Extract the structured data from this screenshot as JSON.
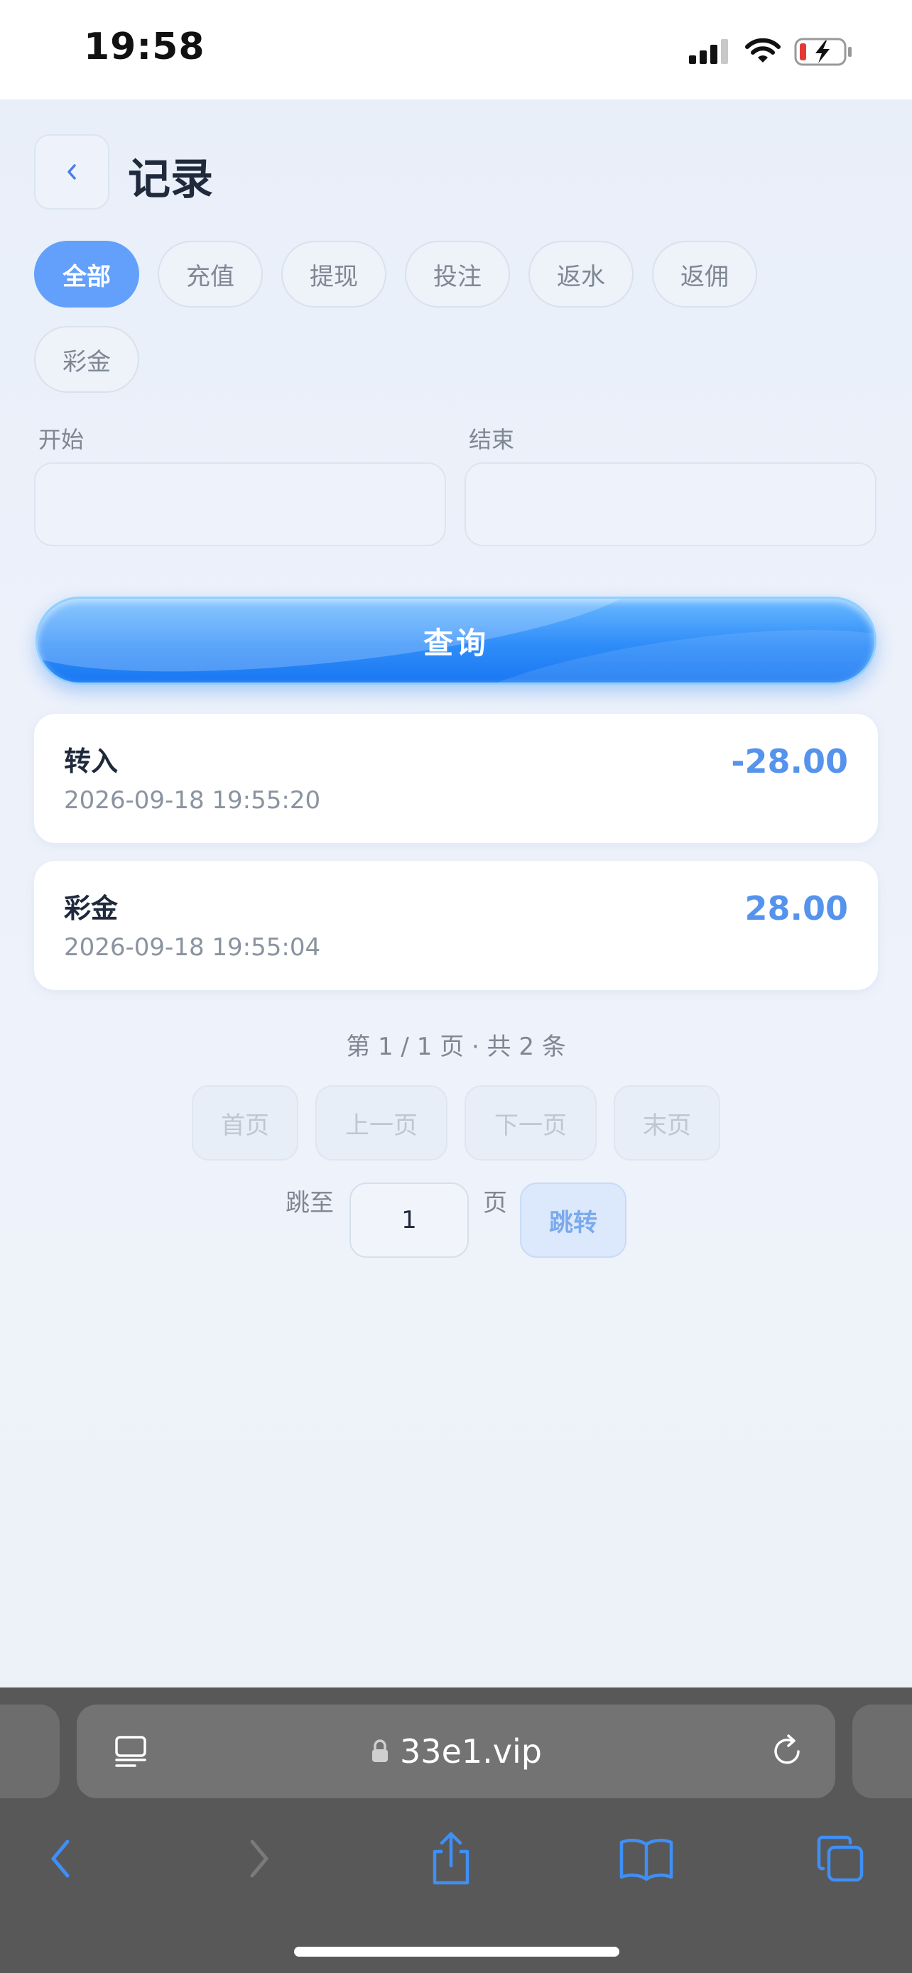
{
  "status_bar": {
    "time": "19:58"
  },
  "header": {
    "title": "记录"
  },
  "filters": {
    "chips": [
      {
        "label": "全部",
        "active": true
      },
      {
        "label": "充值",
        "active": false
      },
      {
        "label": "提现",
        "active": false
      },
      {
        "label": "投注",
        "active": false
      },
      {
        "label": "返水",
        "active": false
      },
      {
        "label": "返佣",
        "active": false
      },
      {
        "label": "彩金",
        "active": false
      }
    ],
    "start_label": "开始",
    "end_label": "结束",
    "start_value": "",
    "end_value": "",
    "query_label": "查询"
  },
  "records": [
    {
      "type": "转入",
      "time": "2026-09-18 19:55:20",
      "amount": "-28.00"
    },
    {
      "type": "彩金",
      "time": "2026-09-18 19:55:04",
      "amount": "28.00"
    }
  ],
  "pagination": {
    "info": "第 1 / 1 页 · 共 2 条",
    "first_label": "首页",
    "prev_label": "上一页",
    "next_label": "下一页",
    "last_label": "末页",
    "jump_prefix": "跳至",
    "jump_value": "1",
    "jump_suffix": "页",
    "jump_button": "跳转"
  },
  "browser": {
    "url": "33e1.vip"
  },
  "colors": {
    "accent": "#63a0fb",
    "amount": "#5593ec",
    "browser_icon": "#3f8ff5"
  }
}
